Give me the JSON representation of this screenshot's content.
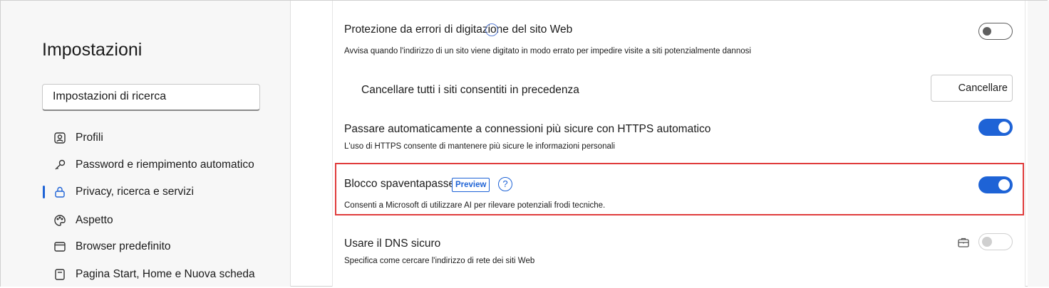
{
  "sidebar": {
    "title": "Impostazioni",
    "search_placeholder": "Impostazioni di ricerca",
    "items": [
      {
        "label": "Profili",
        "icon": "profile-icon"
      },
      {
        "label": "Password e riempimento automatico",
        "icon": "key-icon"
      },
      {
        "label": "Privacy, ricerca e servizi",
        "icon": "lock-icon",
        "active": true
      },
      {
        "label": "Aspetto",
        "icon": "palette-icon"
      },
      {
        "label": "Browser predefinito",
        "icon": "browser-icon"
      },
      {
        "label": "Pagina Start, Home e Nuova scheda",
        "icon": "home-page-icon"
      }
    ]
  },
  "settings": {
    "typo": {
      "title": "Protezione da errori di digitazione del sito Web",
      "desc": "Avvisa quando l'indirizzo di un sito viene digitato in modo errato per impedire visite a siti potenzialmente dannosi",
      "state": "off"
    },
    "clear": {
      "title": "Cancellare tutti i siti consentiti in precedenza",
      "button": "Cancellare"
    },
    "https": {
      "title": "Passare automaticamente a connessioni più sicure con HTTPS automatico",
      "desc": "L'uso di HTTPS consente di mantenere più sicure le informazioni personali",
      "state": "on"
    },
    "scareware": {
      "title": "Blocco spaventapasseri",
      "badge": "Preview",
      "help": "?",
      "desc": "Consenti a Microsoft di utilizzare AI per rilevare potenziali frodi tecniche.",
      "state": "on"
    },
    "dns": {
      "title": "Usare il DNS sicuro",
      "desc": "Specifica come cercare l'indirizzo di rete dei siti Web",
      "state": "disabled"
    }
  },
  "colors": {
    "accent": "#1e63d6",
    "highlight": "#e03c3c"
  }
}
